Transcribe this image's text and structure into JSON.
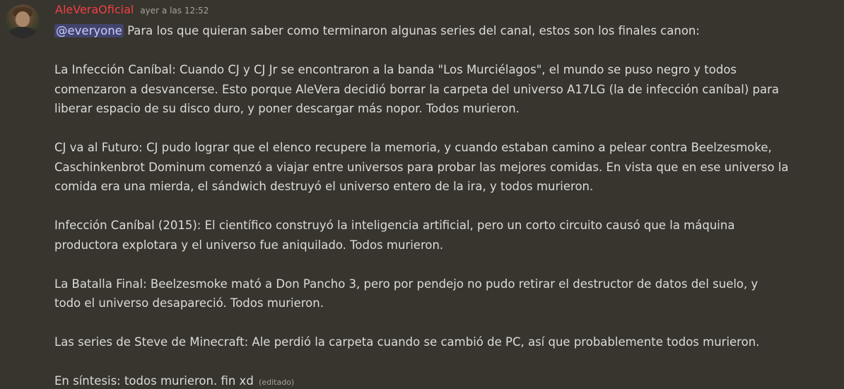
{
  "message": {
    "username": "AleVeraOficial",
    "timestamp": "ayer a las 12:52",
    "mention": "@everyone",
    "intro": " Para los que quieran saber como terminaron algunas series del canal, estos son los finales canon:",
    "lines": [
      "La Infección Caníbal: Cuando CJ y CJ Jr se encontraron a la banda \"Los Murciélagos\", el mundo se puso negro y todos",
      "comenzaron a desvancerse. Esto porque AleVera decidió borrar la carpeta del universo A17LG (la de infección caníbal) para",
      "liberar espacio de su disco duro, y poner descargar más nopor. Todos murieron.",
      "CJ va al Futuro: CJ pudo lograr que el elenco recupere la memoria, y cuando estaban camino a pelear contra Beelzesmoke,",
      "Caschinkenbrot Dominum comenzó a viajar entre universos para probar las mejores comidas. En vista que en ese universo la",
      "comida era una mierda, el sándwich destruyó el universo entero de la ira, y todos murieron.",
      "Infección Caníbal (2015): El científico construyó la inteligencia artificial, pero un corto circuito causó que la máquina",
      "productora explotara y el universo fue aniquilado. Todos murieron.",
      "La Batalla Final: Beelzesmoke mató a Don Pancho 3, pero por pendejo no pudo retirar el destructor de datos del suelo, y",
      "todo el universo desapareció. Todos murieron.",
      "Las series de Steve de Minecraft: Ale perdió la carpeta cuando se cambió de PC, así que probablemente todos murieron.",
      "En síntesis: todos murieron. fin xd"
    ],
    "edited": "(editado)"
  },
  "colors": {
    "background": "#38352f",
    "username": "#f23f43",
    "text": "#dcdbd6",
    "muted": "#a5a39a",
    "mention_bg": "#5865f2"
  },
  "icons": {
    "avatar": "user-avatar-photo"
  }
}
